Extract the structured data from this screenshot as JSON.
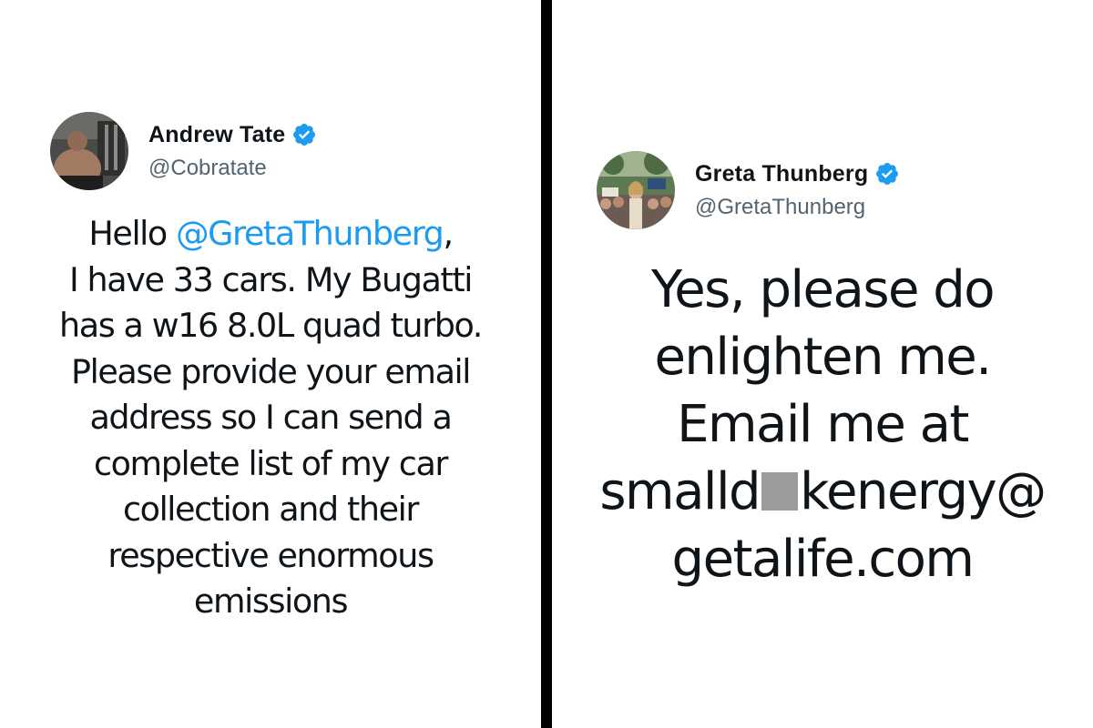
{
  "left_tweet": {
    "author": {
      "display_name": "Andrew Tate",
      "handle": "@Cobratate",
      "verified_icon": "verified-badge-icon",
      "avatar_icon": "profile-photo"
    },
    "body": {
      "greeting": "Hello ",
      "mention": "@GretaThunberg",
      "greeting_punct": ",",
      "lines": [
        "I have 33 cars. My Bugatti",
        "has a w16 8.0L quad turbo.",
        "Please provide your email",
        "address so I can send a",
        "complete list of my car",
        "collection and their",
        "respective enormous",
        "emissions"
      ]
    }
  },
  "right_tweet": {
    "author": {
      "display_name": "Greta Thunberg",
      "handle": "@GretaThunberg",
      "verified_icon": "verified-badge-icon",
      "avatar_icon": "profile-photo"
    },
    "body": {
      "lines": [
        "Yes, please do",
        "enlighten me.",
        "Email me at"
      ],
      "email_part1": "smalld",
      "email_part2": "kenergy@",
      "email_domain": "getalife.com"
    }
  },
  "colors": {
    "mention": "#1d9bf0",
    "verified": "#1d9bf0",
    "handle": "#536471",
    "text": "#0f1419",
    "divider": "#000000",
    "redaction": "#9b9b9b"
  }
}
